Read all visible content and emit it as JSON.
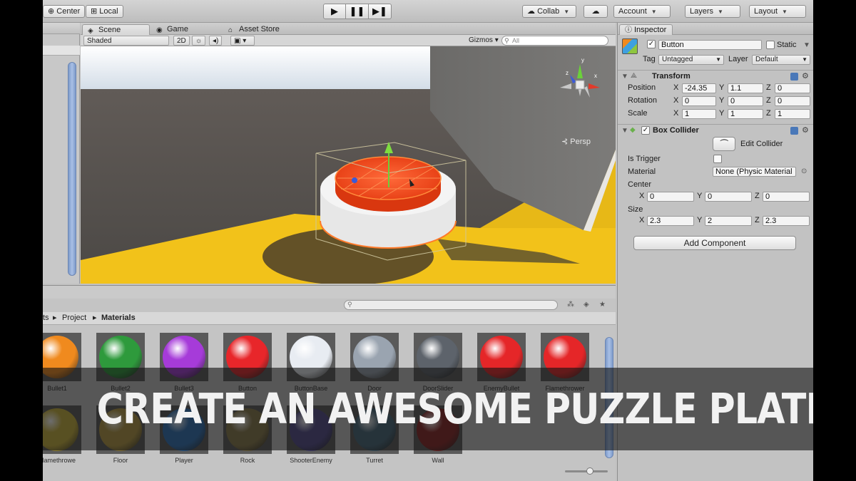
{
  "toolbar": {
    "pivot_label": "Center",
    "space_label": "Local",
    "collab_label": "Collab",
    "account_label": "Account",
    "layers_label": "Layers",
    "layout_label": "Layout"
  },
  "scene": {
    "tabs": [
      {
        "label": "Scene",
        "icon": "scene-icon"
      },
      {
        "label": "Game",
        "icon": "game-icon"
      },
      {
        "label": "Asset Store",
        "icon": "store-icon"
      }
    ],
    "shading_mode": "Shaded",
    "mode_2d": "2D",
    "gizmos_label": "Gizmos",
    "search_placeholder": "All",
    "projection_label": "Persp",
    "colors": {
      "sky": "#dfe9f2",
      "floor": "#f2c21a",
      "ground": "#5c5753",
      "platform_red": "#f24a1c",
      "wall": "#6f6e6c"
    }
  },
  "inspector": {
    "tab_label": "Inspector",
    "object_name": "Button",
    "static_label": "Static",
    "tag_label": "Tag",
    "tag_value": "Untagged",
    "layer_label": "Layer",
    "layer_value": "Default",
    "transform": {
      "title": "Transform",
      "position_label": "Position",
      "rotation_label": "Rotation",
      "scale_label": "Scale",
      "position": {
        "x": "-24.35",
        "y": "1.1",
        "z": "0"
      },
      "rotation": {
        "x": "0",
        "y": "0",
        "z": "0"
      },
      "scale": {
        "x": "1",
        "y": "1",
        "z": "1"
      }
    },
    "box_collider": {
      "title": "Box Collider",
      "edit_collider_label": "Edit Collider",
      "is_trigger_label": "Is Trigger",
      "material_label": "Material",
      "material_value": "None (Physic Material",
      "center_label": "Center",
      "center": {
        "x": "0",
        "y": "0",
        "z": "0"
      },
      "size_label": "Size",
      "size": {
        "x": "2.3",
        "y": "2",
        "z": "2.3"
      }
    },
    "add_component_label": "Add Component",
    "axis": {
      "x": "X",
      "y": "Y",
      "z": "Z"
    }
  },
  "project": {
    "breadcrumb": [
      "ts",
      "Project",
      "Materials"
    ],
    "materials_row1": [
      {
        "name": "Bullet1",
        "color": "#f08a1e"
      },
      {
        "name": "Bullet2",
        "color": "#2e9a3c"
      },
      {
        "name": "Bullet3",
        "color": "#a63bd9"
      },
      {
        "name": "Button",
        "color": "#e8262a"
      },
      {
        "name": "ButtonBase",
        "color": "#e8ecf2"
      },
      {
        "name": "Door",
        "color": "#9aa4b0"
      },
      {
        "name": "DoorSlider",
        "color": "#5d636b"
      },
      {
        "name": "EnemyBullet",
        "color": "#e52628"
      },
      {
        "name": "Flamethrower",
        "color": "#e52628"
      }
    ],
    "materials_row2": [
      {
        "name": "Flamethrowe",
        "color": "#c9b23a"
      },
      {
        "name": "Floor",
        "color": "#b59a42"
      },
      {
        "name": "Player",
        "color": "#2f72b8"
      },
      {
        "name": "Rock",
        "color": "#8a7b4a"
      },
      {
        "name": "ShooterEnemy",
        "color": "#514a8c"
      },
      {
        "name": "Turret",
        "color": "#46677a"
      },
      {
        "name": "Wall",
        "color": "#8a2222"
      }
    ]
  },
  "banner": {
    "title": "CREATE AN AWESOME PUZZLE PLATFORMER"
  }
}
